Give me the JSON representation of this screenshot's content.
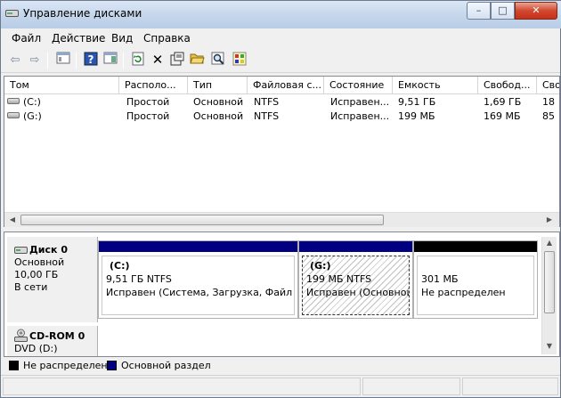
{
  "window": {
    "title": "Управление дисками"
  },
  "titlebar_buttons": {
    "minimize": "–",
    "maximize": "□",
    "close": "✕"
  },
  "menu": [
    "Файл",
    "Действие",
    "Вид",
    "Справка"
  ],
  "toolbar": {
    "icons": [
      "back-arrow-icon",
      "forward-arrow-icon",
      "console-tree-icon",
      "help-icon",
      "properties-pane-icon",
      "refresh-icon",
      "delete-icon",
      "properties-icon",
      "open-folder-icon",
      "search-icon",
      "wizard-icon"
    ]
  },
  "volume_list": {
    "columns": [
      "Том",
      "Располо...",
      "Тип",
      "Файловая с...",
      "Состояние",
      "Емкость",
      "Свобод...",
      "Сво"
    ],
    "rows": [
      {
        "volume": "(C:)",
        "layout": "Простой",
        "type": "Основной",
        "fs": "NTFS",
        "status": "Исправен...",
        "capacity": "9,51 ГБ",
        "free": "1,69 ГБ",
        "free_pct": "18"
      },
      {
        "volume": "(G:)",
        "layout": "Простой",
        "type": "Основной",
        "fs": "NTFS",
        "status": "Исправен...",
        "capacity": "199 МБ",
        "free": "169 МБ",
        "free_pct": "85"
      }
    ]
  },
  "disks": [
    {
      "name": "Диск 0",
      "kind": "Основной",
      "size": "10,00 ГБ",
      "state": "В сети",
      "partitions": [
        {
          "title": "(C:)",
          "size_fs": "9,51 ГБ NTFS",
          "status": "Исправен (Система, Загрузка, Файл подкачки",
          "bar_color": "#000080"
        },
        {
          "title": "(G:)",
          "size_fs": "199 МБ NTFS",
          "status": "Исправен (Основной раздел)",
          "bar_color": "#000080"
        },
        {
          "title": "",
          "size_fs": "301 МБ",
          "status": "Не распределен",
          "bar_color": "#000000"
        }
      ]
    },
    {
      "name": "CD-ROM 0",
      "kind": "DVD (D:)"
    }
  ],
  "legend": [
    {
      "label": "Не распределен",
      "color": "#000000"
    },
    {
      "label": "Основной раздел",
      "color": "#000080"
    }
  ]
}
